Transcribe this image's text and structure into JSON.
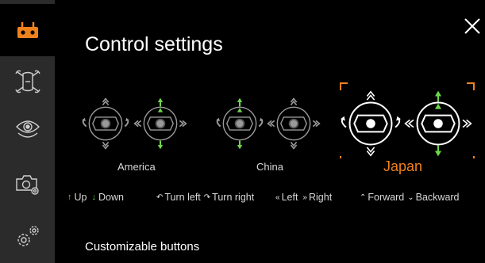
{
  "page": {
    "title": "Control settings",
    "close_icon": "close-icon"
  },
  "sidebar": {
    "items": [
      {
        "name": "remote-controller-icon",
        "active": true
      },
      {
        "name": "drone-icon",
        "active": false
      },
      {
        "name": "vision-icon",
        "active": false
      },
      {
        "name": "camera-settings-icon",
        "active": false
      },
      {
        "name": "general-settings-icon",
        "active": false
      }
    ],
    "accent": "#f0821e"
  },
  "modes": [
    {
      "label": "America",
      "selected": false
    },
    {
      "label": "China",
      "selected": false
    },
    {
      "label": "Japan",
      "selected": true
    }
  ],
  "legend": {
    "up": "Up",
    "down": "Down",
    "turn_left": "Turn left",
    "turn_right": "Turn right",
    "left": "Left",
    "right": "Right",
    "forward": "Forward",
    "backward": "Backward"
  },
  "colors": {
    "accent": "#f0821e",
    "green": "#6fd64a",
    "sidebar_bg": "#2b2b2b"
  },
  "sections": {
    "customizable_buttons": "Customizable buttons"
  }
}
